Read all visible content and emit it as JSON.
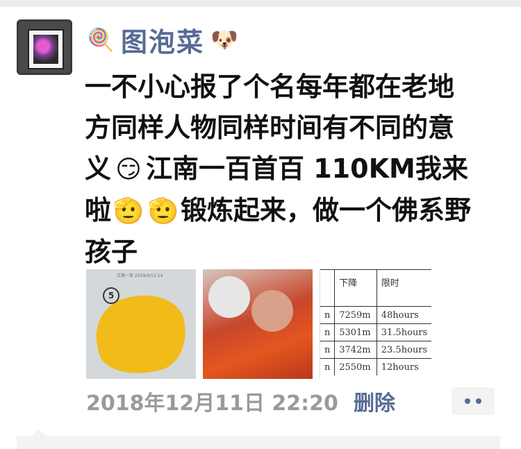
{
  "post": {
    "username": "图泡菜",
    "name_prefix_icon": "lollipop-emoji",
    "name_suffix_icon": "dog-face-emoji",
    "text": {
      "part1": "一不小心报了个名每年都在老地方同样人物同样时间有不同的意义",
      "emoji1": "smirk-emoji",
      "part2": "江南一百首百 110KM我来啦",
      "emoji2": "salute-emoji",
      "part3": "锻炼起来，做一个佛系野孩子"
    },
    "timestamp": "2018年12月11日 22:20",
    "delete_label": "删除",
    "more_label": "••"
  },
  "images": {
    "map": {
      "badge": "5",
      "caption": "江南一百 2019/4/12-14"
    },
    "table": {
      "headers": [
        "",
        "下降",
        "限时"
      ],
      "rows": [
        [
          "n",
          "7259m",
          "48hours"
        ],
        [
          "n",
          "5301m",
          "31.5hours"
        ],
        [
          "n",
          "3742m",
          "23.5hours"
        ],
        [
          "n",
          "2550m",
          "12hours"
        ]
      ]
    }
  },
  "colors": {
    "link": "#576b95",
    "timestamp": "#9a9a9a",
    "text": "#111111"
  }
}
